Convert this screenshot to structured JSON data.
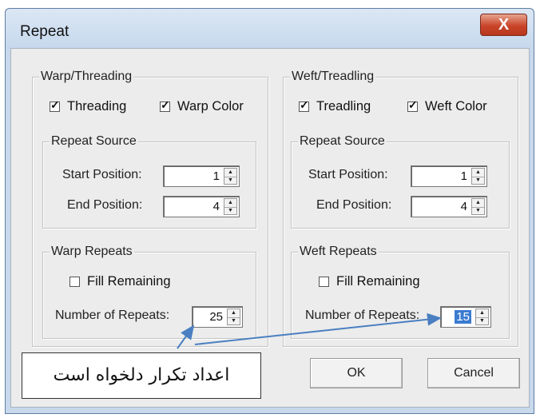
{
  "window": {
    "title": "Repeat",
    "close_glyph": "X"
  },
  "warp": {
    "group_label": "Warp/Threading",
    "threading": {
      "label": "Threading",
      "checked": true
    },
    "warp_color": {
      "label": "Warp Color",
      "checked": true
    },
    "source": {
      "label": "Repeat Source",
      "start_label": "Start Position:",
      "start_value": "1",
      "end_label": "End Position:",
      "end_value": "4"
    },
    "repeats": {
      "label": "Warp Repeats",
      "fill_label": "Fill Remaining",
      "fill_checked": false,
      "number_label": "Number of Repeats:",
      "number_value": "25"
    }
  },
  "weft": {
    "group_label": "Weft/Treadling",
    "treadling": {
      "label": "Treadling",
      "checked": true
    },
    "weft_color": {
      "label": "Weft Color",
      "checked": true
    },
    "source": {
      "label": "Repeat Source",
      "start_label": "Start Position:",
      "start_value": "1",
      "end_label": "End Position:",
      "end_value": "4"
    },
    "repeats": {
      "label": "Weft Repeats",
      "fill_label": "Fill Remaining",
      "fill_checked": false,
      "number_label": "Number of Repeats:",
      "number_value": "15"
    }
  },
  "buttons": {
    "ok": "OK",
    "cancel": "Cancel"
  },
  "annotation": {
    "text": "اعداد تکرار دلخواه است",
    "arrow_color": "#4a7fc1"
  }
}
